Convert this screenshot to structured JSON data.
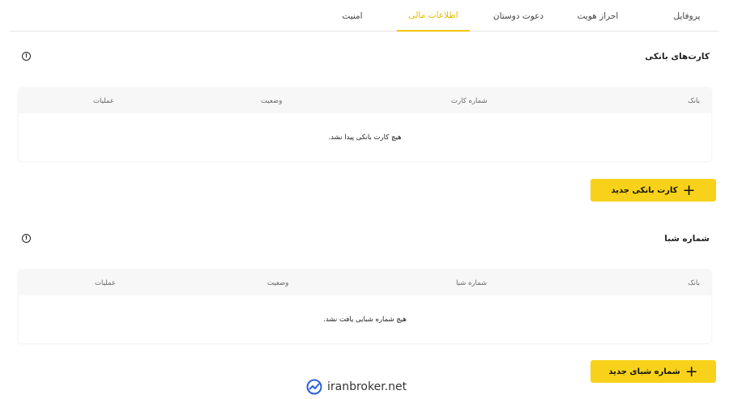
{
  "tabs": [
    {
      "label": "پروفایل"
    },
    {
      "label": "احراز هویت"
    },
    {
      "label": "دعوت دوستان"
    },
    {
      "label": "اطلاعات مالی"
    },
    {
      "label": "امنیت"
    }
  ],
  "bank_cards": {
    "title": "کارت‌های بانکی",
    "columns": {
      "bank": "بانک",
      "card_number": "شماره کارت",
      "status": "وضعیت",
      "actions": "عملیات"
    },
    "empty_text": "هیچ کارت بانکی پیدا نشد.",
    "add_button_label": "کارت بانکی جدید"
  },
  "sheba": {
    "title": "شماره شبا",
    "columns": {
      "bank": "بانک",
      "sheba_number": "شماره شبا",
      "status": "وضعیت",
      "actions": "عملیات"
    },
    "empty_text": "هیچ شماره شبایی یافت نشد.",
    "add_button_label": "شماره شبای جدید"
  },
  "watermark": {
    "text": "iranbroker.net"
  },
  "colors": {
    "accent": "#f8d21a",
    "active_tab": "#e8b800"
  }
}
